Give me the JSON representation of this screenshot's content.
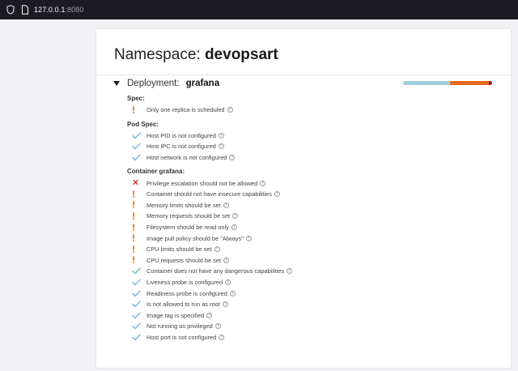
{
  "browser": {
    "url_host": "127.0.0.1",
    "url_port": ":8080"
  },
  "namespace": {
    "label": "Namespace:",
    "name": "devopsart"
  },
  "deployment": {
    "label": "Deployment:",
    "name": "grafana",
    "score_colors": [
      "#9ed1df",
      "#e36a1e",
      "#a3123c"
    ],
    "score_fractions": [
      0.53,
      0.43,
      0.04
    ]
  },
  "sections": [
    {
      "title": "Spec:",
      "items": [
        {
          "status": "warning",
          "text": "Only one replica is scheduled"
        }
      ]
    },
    {
      "title": "Pod Spec:",
      "items": [
        {
          "status": "success",
          "text": "Host PID is not configured"
        },
        {
          "status": "success",
          "text": "Host IPC is not configured"
        },
        {
          "status": "success",
          "text": "Host network is not configured"
        }
      ]
    },
    {
      "title": "Container grafana:",
      "items": [
        {
          "status": "danger",
          "text": "Privilege escalation should not be allowed"
        },
        {
          "status": "warning",
          "text": "Container should not have insecure capabilities"
        },
        {
          "status": "warning",
          "text": "Memory limits should be set"
        },
        {
          "status": "warning",
          "text": "Memory requests should be set"
        },
        {
          "status": "warning",
          "text": "Filesystem should be read only"
        },
        {
          "status": "warning",
          "text": "Image pull policy should be \"Always\""
        },
        {
          "status": "warning",
          "text": "CPU limits should be set"
        },
        {
          "status": "warning",
          "text": "CPU requests should be set"
        },
        {
          "status": "success",
          "text": "Container does not have any dangerous capabilities"
        },
        {
          "status": "success",
          "text": "Liveness probe is configured"
        },
        {
          "status": "success",
          "text": "Readiness probe is configured"
        },
        {
          "status": "success",
          "text": "Is not allowed to run as root"
        },
        {
          "status": "success",
          "text": "Image tag is specified"
        },
        {
          "status": "success",
          "text": "Not running as privileged"
        },
        {
          "status": "success",
          "text": "Host port is not configured"
        }
      ]
    }
  ],
  "icons": {
    "warning": "exclamation-icon",
    "danger": "cross-icon",
    "success": "checkmark-icon",
    "help": "question-circle-icon"
  },
  "colors": {
    "warning": "#e36a0a",
    "danger": "#b3121c",
    "success": "#7fbfcf"
  }
}
